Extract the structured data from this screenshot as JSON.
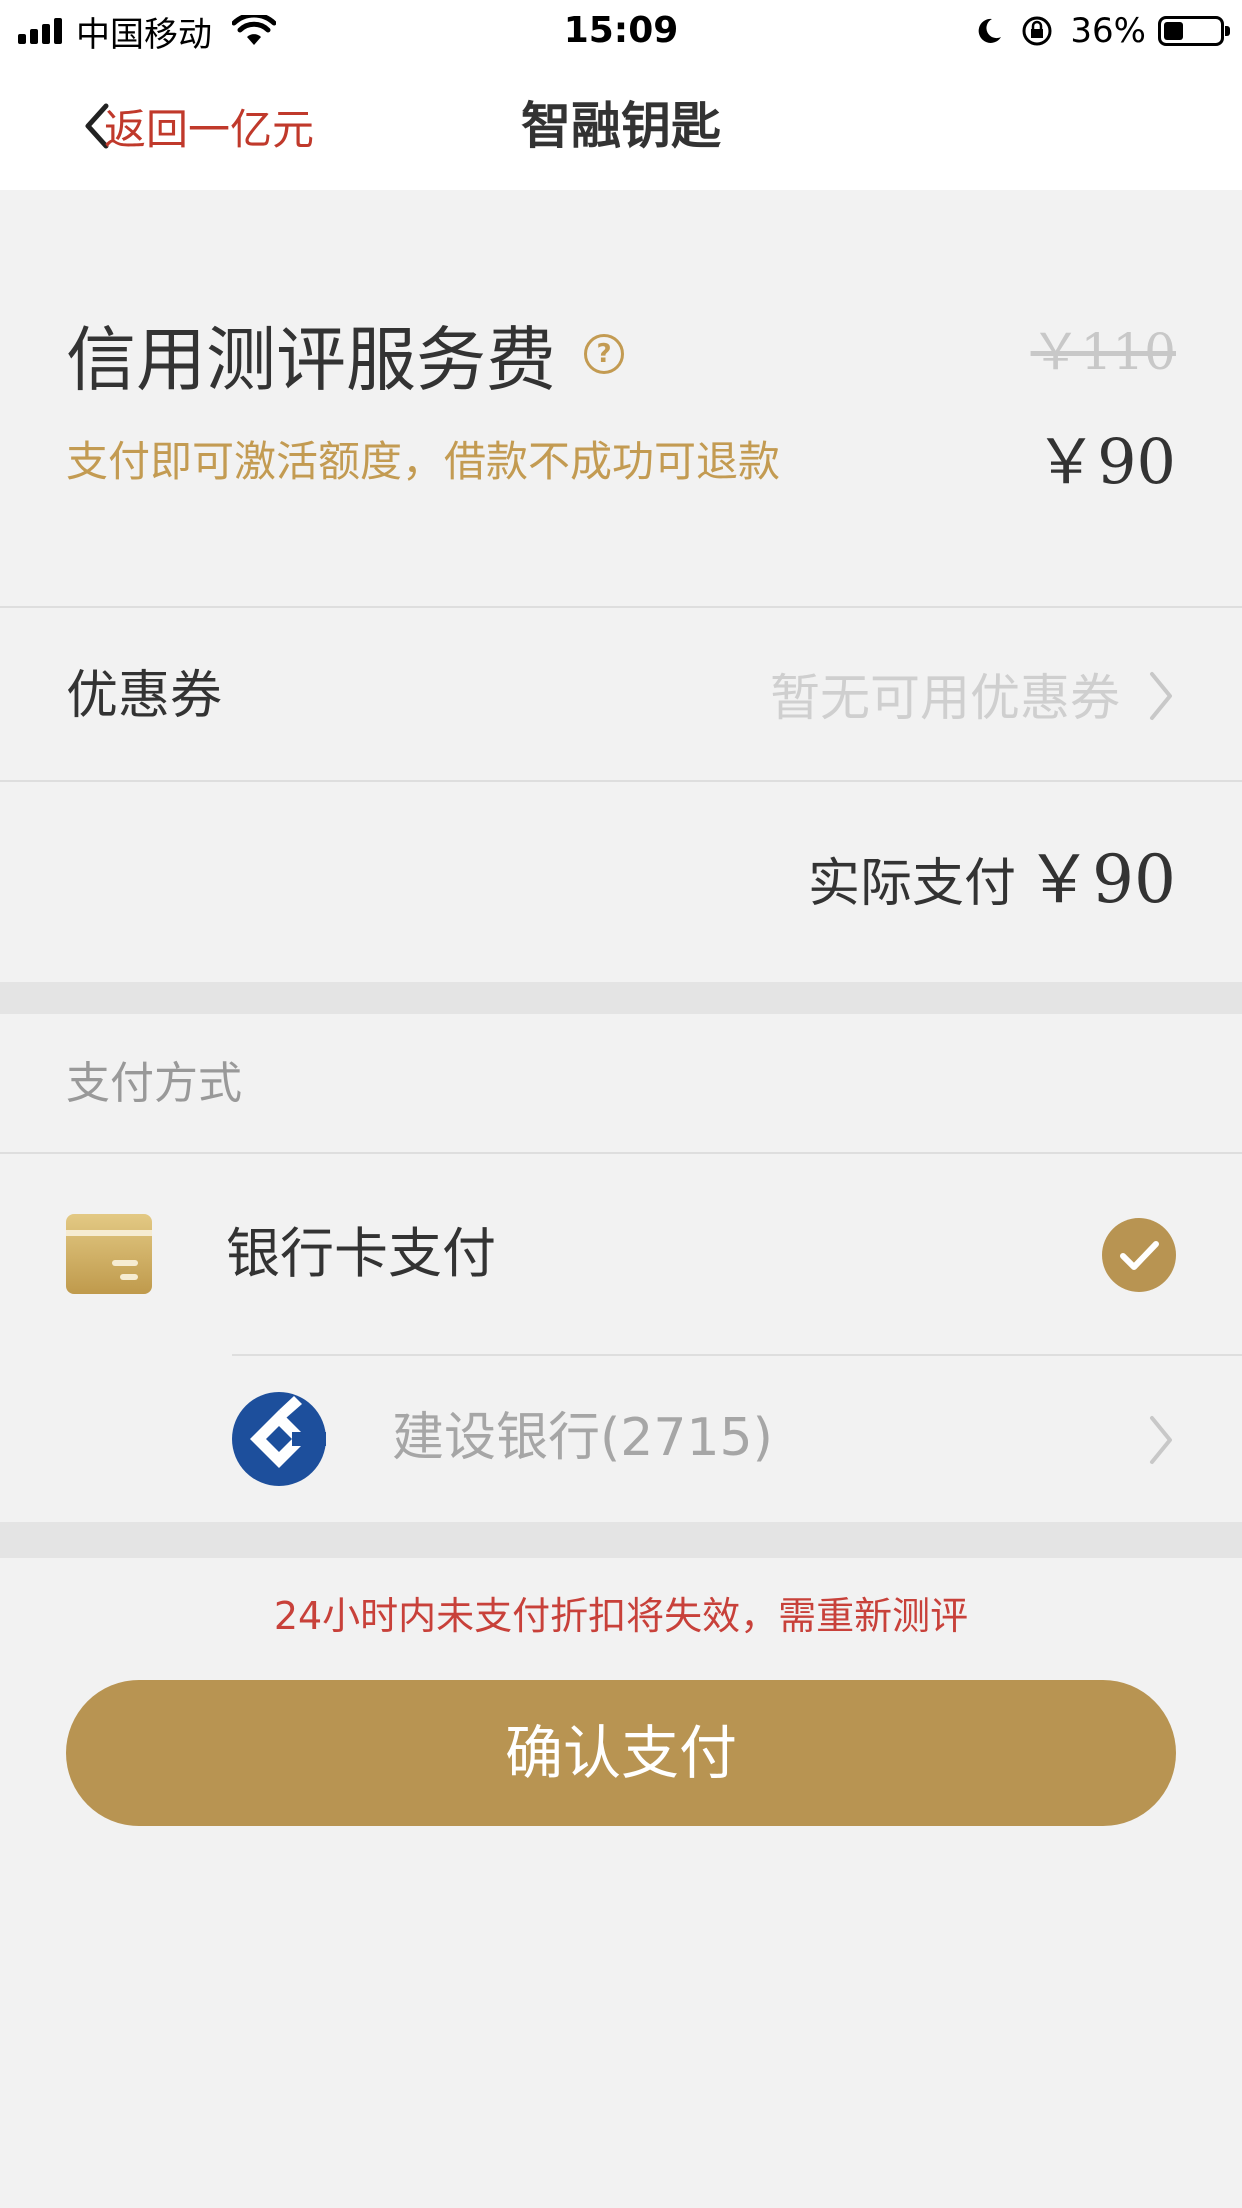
{
  "status_bar": {
    "carrier": "中国移动",
    "time": "15:09",
    "battery": "36%",
    "battery_level": 0.36
  },
  "nav": {
    "back_label": "返回一亿元",
    "title": "智融钥匙"
  },
  "fee": {
    "title": "信用测评服务费",
    "help_icon": "?",
    "original_price": "￥110",
    "subtitle": "支付即可激活额度，借款不成功可退款",
    "current_price": "￥90"
  },
  "coupon": {
    "label": "优惠券",
    "value": "暂无可用优惠券"
  },
  "actual": {
    "label": "实际支付",
    "amount": "￥90"
  },
  "payment": {
    "header": "支付方式",
    "method_label": "银行卡支付",
    "method_selected": true,
    "bank_name": "建设银行(2715)"
  },
  "warning": "24小时内未支付折扣将失效，需重新测评",
  "confirm_label": "确认支付",
  "colors": {
    "accent_gold": "#b89452",
    "subtitle_gold": "#c39b52",
    "warning_red": "#c8413a",
    "back_red": "#c0392b",
    "ccb_blue": "#1d4f9c"
  }
}
